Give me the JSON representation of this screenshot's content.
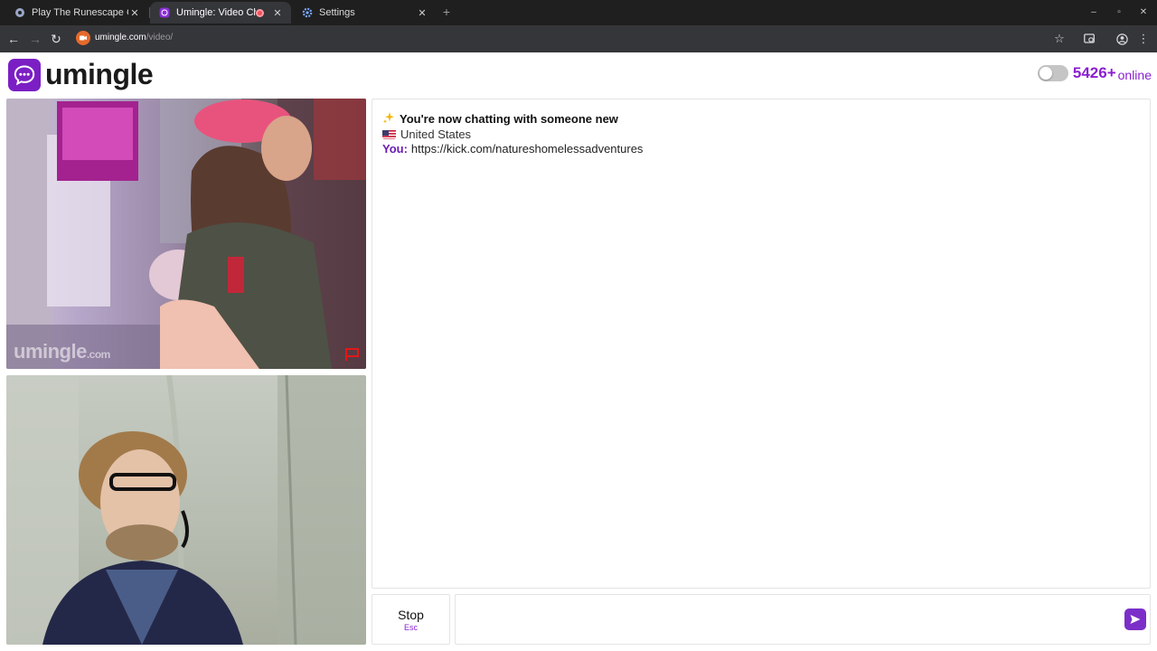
{
  "browser": {
    "tabs": [
      {
        "title": "Play The Runescape Cras",
        "icon": "runescape-icon"
      },
      {
        "title": "Umingle: Video Chat",
        "icon": "umingle-icon",
        "active": true,
        "recording": true
      },
      {
        "title": "Settings",
        "icon": "gear-icon"
      }
    ],
    "url_host": "umingle.com",
    "url_path": "/video/"
  },
  "brand": {
    "name": "umingle",
    "color": "#7b1fc4"
  },
  "online": {
    "count": "5426+",
    "label": "online",
    "toggle_on": false
  },
  "videos": {
    "stranger_watermark": "umingle",
    "stranger_watermark_suffix": ".com"
  },
  "chat": {
    "status": "You're now chatting with someone new",
    "status_icon": "sparkles-icon",
    "country": "United States",
    "messages": [
      {
        "sender": "You:",
        "text": "https://kick.com/natureshomelessadventures"
      }
    ]
  },
  "controls": {
    "stop_label": "Stop",
    "stop_hint": "Esc",
    "message_value": "",
    "accent": "#7b2fc8"
  }
}
